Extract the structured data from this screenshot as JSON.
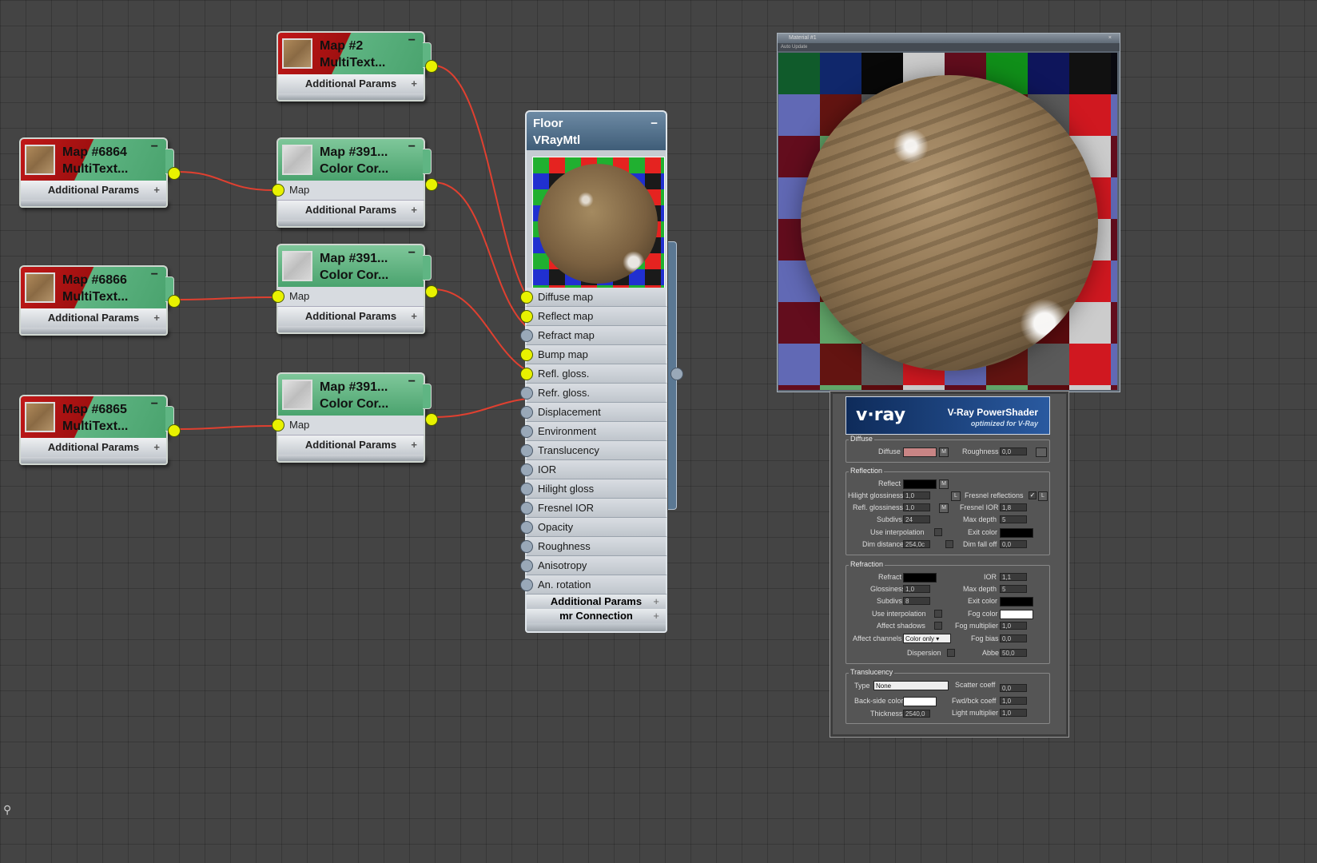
{
  "map_nodes": [
    {
      "id": "map2",
      "title_line1": "Map #2",
      "title_line2": "MultiText...",
      "additional": "Additional Params"
    },
    {
      "id": "map6864",
      "title_line1": "Map #6864",
      "title_line2": "MultiText...",
      "additional": "Additional Params"
    },
    {
      "id": "map6866",
      "title_line1": "Map #6866",
      "title_line2": "MultiText...",
      "additional": "Additional Params"
    },
    {
      "id": "map6865",
      "title_line1": "Map #6865",
      "title_line2": "MultiText...",
      "additional": "Additional Params"
    }
  ],
  "cc_nodes": [
    {
      "id": "cc1",
      "title_line1": "Map #391...",
      "title_line2": "Color Cor...",
      "input": "Map",
      "additional": "Additional Params"
    },
    {
      "id": "cc2",
      "title_line1": "Map #391...",
      "title_line2": "Color Cor...",
      "input": "Map",
      "additional": "Additional Params"
    },
    {
      "id": "cc3",
      "title_line1": "Map #391...",
      "title_line2": "Color Cor...",
      "input": "Map",
      "additional": "Additional Params"
    }
  ],
  "material_node": {
    "name": "Floor",
    "type": "VRayMtl",
    "slots": [
      {
        "label": "Diffuse map",
        "connected": true
      },
      {
        "label": "Reflect map",
        "connected": true
      },
      {
        "label": "Refract map",
        "connected": false
      },
      {
        "label": "Bump map",
        "connected": true
      },
      {
        "label": "Refl. gloss.",
        "connected": true
      },
      {
        "label": "Refr. gloss.",
        "connected": false
      },
      {
        "label": "Displacement",
        "connected": false
      },
      {
        "label": "Environment",
        "connected": false
      },
      {
        "label": "Translucency",
        "connected": false
      },
      {
        "label": "IOR",
        "connected": false
      },
      {
        "label": "Hilight gloss",
        "connected": false
      },
      {
        "label": "Fresnel IOR",
        "connected": false
      },
      {
        "label": "Opacity",
        "connected": false
      },
      {
        "label": "Roughness",
        "connected": false
      },
      {
        "label": "Anisotropy",
        "connected": false
      },
      {
        "label": "An. rotation",
        "connected": false
      }
    ],
    "additional": "Additional Params",
    "mr": "mr Connection"
  },
  "preview_window": {
    "title": "Material #1",
    "menu": "Auto   Update"
  },
  "vray_panel": {
    "logo": "v·ray",
    "product": "V-Ray PowerShader",
    "subtitle": "optimized for V-Ray",
    "colors": {
      "diffuse": "#c98585",
      "reflect": "#000000",
      "refract": "#000000",
      "exit_color": "#000000",
      "fog_color": "#ffffff",
      "back_side_color": "#ffffff"
    },
    "diffuse": {
      "group": "Diffuse",
      "label": "Diffuse",
      "m": "M",
      "roughness_label": "Roughness",
      "roughness": "0,0"
    },
    "reflection": {
      "group": "Reflection",
      "reflect_label": "Reflect",
      "m": "M",
      "hilight_label": "Hilight glossiness",
      "hilight": "1,0",
      "l": "L",
      "fresnel_label": "Fresnel reflections",
      "fresnel_checked": "✓",
      "refl_gloss_label": "Refl. glossiness",
      "refl_gloss": "1,0",
      "fresnel_ior_label": "Fresnel IOR",
      "fresnel_ior": "1,8",
      "subdivs_label": "Subdivs",
      "subdivs": "24",
      "max_depth_label": "Max depth",
      "max_depth": "5",
      "use_interp_label": "Use interpolation",
      "exit_color_label": "Exit color",
      "dim_dist_label": "Dim distance",
      "dim_dist": "254,0c",
      "dim_falloff_label": "Dim fall off",
      "dim_falloff": "0,0"
    },
    "refraction": {
      "group": "Refraction",
      "refract_label": "Refract",
      "ior_label": "IOR",
      "ior": "1,1",
      "gloss_label": "Glossiness",
      "gloss": "1,0",
      "max_depth_label": "Max depth",
      "max_depth": "5",
      "subdivs_label": "Subdivs",
      "subdivs": "8",
      "exit_color_label": "Exit color",
      "use_interp_label": "Use interpolation",
      "fog_color_label": "Fog color",
      "affect_shadows_label": "Affect shadows",
      "fog_mult_label": "Fog multiplier",
      "fog_mult": "1,0",
      "affect_channels_label": "Affect channels",
      "affect_channels": "Color only",
      "fog_bias_label": "Fog bias",
      "fog_bias": "0,0",
      "dispersion_label": "Dispersion",
      "abbe_label": "Abbe",
      "abbe": "50,0"
    },
    "translucency": {
      "group": "Translucency",
      "type_label": "Type",
      "type": "None",
      "scatter_label": "Scatter coeff",
      "scatter": "0,0",
      "back_side_label": "Back-side color",
      "fwd_label": "Fwd/bck coeff",
      "fwd": "1,0",
      "light_mult_label": "Light multiplier",
      "light_mult": "1,0",
      "thickness_label": "Thickness",
      "thickness": "2540,0"
    }
  }
}
